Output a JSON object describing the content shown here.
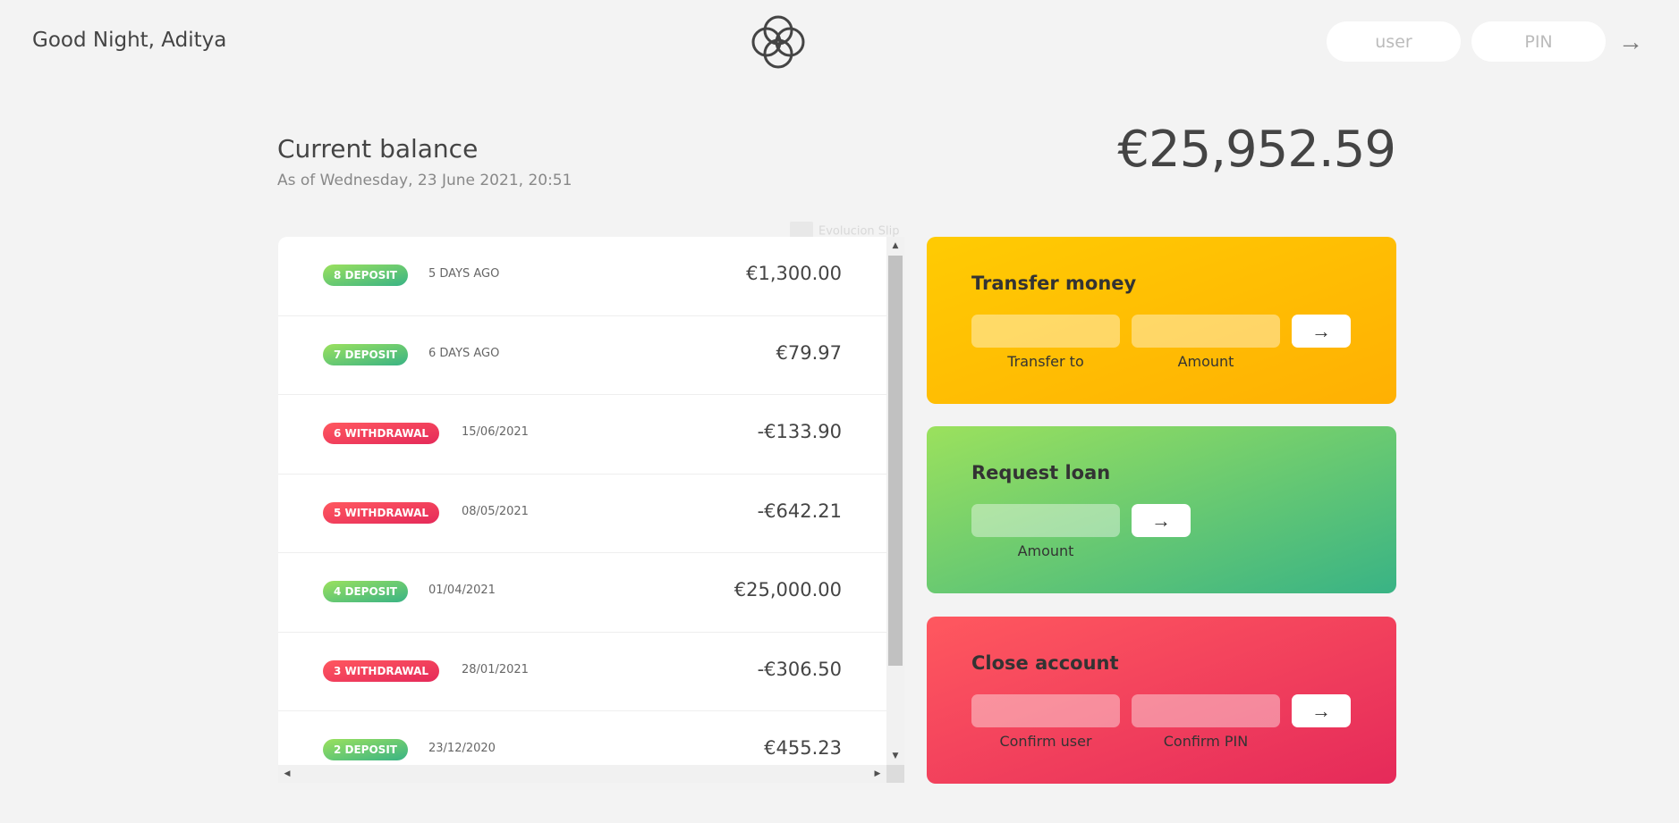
{
  "nav": {
    "welcome": "Good Night, Aditya",
    "user_placeholder": "user",
    "pin_placeholder": "PIN",
    "login_arrow": "→"
  },
  "balance": {
    "label": "Current balance",
    "date": "As of Wednesday, 23 June 2021, 20:51",
    "value": "€25,952.59"
  },
  "ghost_tooltip": "Evolucion Slip",
  "movements": [
    {
      "type": "deposit",
      "label": "8 DEPOSIT",
      "date": "5 DAYS AGO",
      "value": "€1,300.00"
    },
    {
      "type": "deposit",
      "label": "7 DEPOSIT",
      "date": "6 DAYS AGO",
      "value": "€79.97"
    },
    {
      "type": "withdrawal",
      "label": "6 WITHDRAWAL",
      "date": "15/06/2021",
      "value": "-€133.90"
    },
    {
      "type": "withdrawal",
      "label": "5 WITHDRAWAL",
      "date": "08/05/2021",
      "value": "-€642.21"
    },
    {
      "type": "deposit",
      "label": "4 DEPOSIT",
      "date": "01/04/2021",
      "value": "€25,000.00"
    },
    {
      "type": "withdrawal",
      "label": "3 WITHDRAWAL",
      "date": "28/01/2021",
      "value": "-€306.50"
    },
    {
      "type": "deposit",
      "label": "2 DEPOSIT",
      "date": "23/12/2020",
      "value": "€455.23"
    }
  ],
  "scrollbar": {
    "up": "▲",
    "down": "▼",
    "left": "◀",
    "right": "▶"
  },
  "operations": {
    "transfer": {
      "title": "Transfer money",
      "to_label": "Transfer to",
      "amount_label": "Amount",
      "button": "→"
    },
    "loan": {
      "title": "Request loan",
      "amount_label": "Amount",
      "button": "→"
    },
    "close": {
      "title": "Close account",
      "user_label": "Confirm user",
      "pin_label": "Confirm PIN",
      "button": "→"
    }
  },
  "colors": {
    "background": "#f3f3f3",
    "deposit": "#39b385",
    "withdrawal": "#e52a5a",
    "transfer": "#ffb003",
    "loan": "#9be15d",
    "close": "#ff585f"
  },
  "icons": {
    "logo": "four-circles-logo-icon"
  }
}
